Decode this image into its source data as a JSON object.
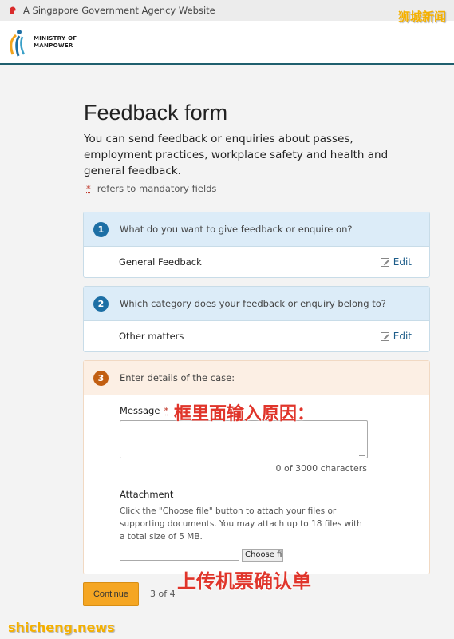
{
  "gov_bar": {
    "text": "A Singapore Government Agency Website"
  },
  "header": {
    "logo_line1": "MINISTRY OF",
    "logo_line2": "MANPOWER"
  },
  "watermark_top": "狮城新闻",
  "watermark_bottom": "shicheng.news",
  "form": {
    "title": "Feedback form",
    "intro": "You can send feedback or enquiries about passes, employment practices, workplace safety and health and general feedback.",
    "mandatory_star": "*",
    "mandatory_note": "refers to mandatory fields",
    "steps": [
      {
        "number": "1",
        "question": "What do you want to give feedback or enquire on?",
        "answer": "General Feedback",
        "edit_label": "Edit"
      },
      {
        "number": "2",
        "question": "Which category does your feedback or enquiry belong to?",
        "answer": "Other matters",
        "edit_label": "Edit"
      },
      {
        "number": "3",
        "question": "Enter details of the case:"
      }
    ],
    "message_label": "Message",
    "message_star": "*",
    "message_value": "",
    "counter": "0 of 3000 characters",
    "attachment_label": "Attachment",
    "attachment_help": "Click the \"Choose file\" button to attach your files or supporting documents. You may attach up to 18 files with a total size of 5 MB.",
    "choose_file_label": "Choose file",
    "continue_label": "Continue",
    "pager": "3 of 4"
  },
  "annotations": {
    "message_note": "框里面输入原因：",
    "upload_note": "上传机票确认单"
  },
  "colors": {
    "accent_blue": "#1d6fa5",
    "step3_orange": "#c25f12",
    "continue_button": "#f5a623",
    "note_red": "#e0352b"
  }
}
